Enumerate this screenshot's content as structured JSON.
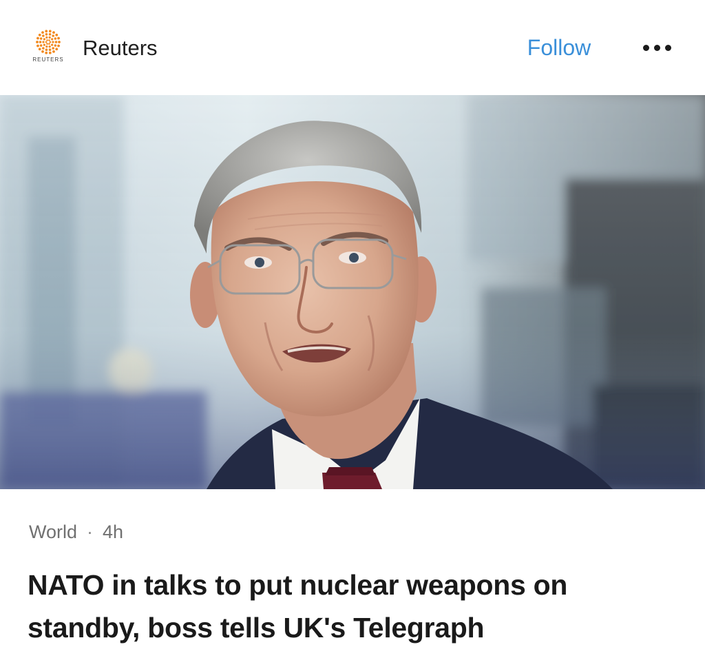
{
  "header": {
    "logo_icon": "reuters-logo-icon",
    "logo_wordmark": "REUTERS",
    "publisher_name": "Reuters",
    "follow_label": "Follow",
    "more_icon": "more-horizontal-icon",
    "follow_color": "#3a8fd9"
  },
  "article": {
    "image_subject": "portrait-photo",
    "category": "World",
    "separator": "·",
    "age": "4h",
    "headline": "NATO in talks to put nuclear weapons on standby, boss tells UK's Telegraph"
  },
  "colors": {
    "background": "#ffffff",
    "text": "#1a1a1a",
    "meta_text": "#707070",
    "accent": "#3a8fd9",
    "logo_orange": "#f28a1f"
  }
}
